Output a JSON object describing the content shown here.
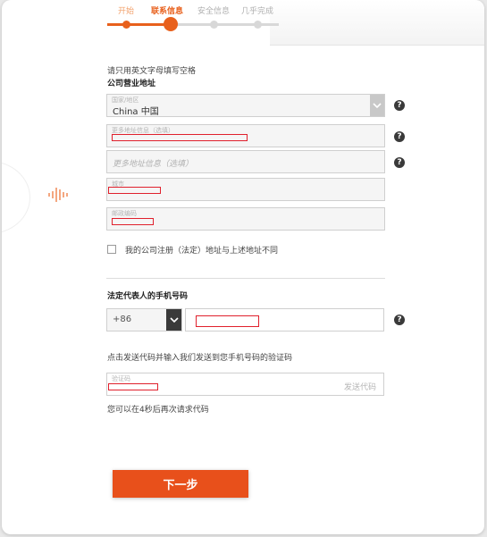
{
  "stepper": {
    "steps": [
      {
        "label": "开始",
        "state": "done"
      },
      {
        "label": "联系信息",
        "state": "active"
      },
      {
        "label": "安全信息",
        "state": "pending"
      },
      {
        "label": "几乎完成",
        "state": "pending"
      }
    ]
  },
  "form": {
    "hint": "请只用英文字母填写空格",
    "address_section_title": "公司营业地址",
    "country": {
      "label": "国家/地区",
      "value": "China 中国"
    },
    "address1": {
      "label": "更多地址信息（选填）"
    },
    "address2": {
      "placeholder": "更多地址信息（选填）"
    },
    "city": {
      "label": "城市"
    },
    "postcode": {
      "label": "邮政编码"
    },
    "different_address_checkbox": {
      "label": "我的公司注册（法定）地址与上述地址不同",
      "checked": false
    },
    "phone_section_title": "法定代表人的手机号码",
    "phone_prefix": "+86",
    "sms_instruction": "点击发送代码并输入我们发送到您手机号码的验证码",
    "verification_code": {
      "label": "验证码",
      "send_button": "发送代码"
    },
    "resend_notice": "您可以在4秒后再次请求代码",
    "next_button": "下一步"
  },
  "icons": {
    "help": "question-mark-icon",
    "select": "chevron-down-icon",
    "side": "arrow-left-icon"
  },
  "colors": {
    "accent": "#e8601c",
    "button": "#e8501b",
    "redaction": "#e0202c"
  }
}
